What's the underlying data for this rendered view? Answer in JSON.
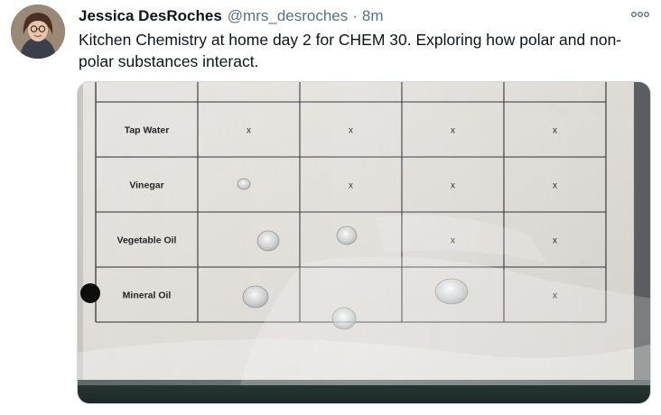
{
  "tweet": {
    "author_name": "Jessica DesRoches",
    "handle": "@mrs_desroches",
    "separator": "·",
    "timestamp": "8m",
    "text": "Kitchen Chemistry at home day 2 for CHEM 30. Exploring how polar and non-polar substances interact."
  },
  "photo": {
    "rows": [
      {
        "label": "Tap Water",
        "cells": [
          "x",
          "x",
          "x",
          "x"
        ]
      },
      {
        "label": "Vinegar",
        "cells": [
          "",
          "x",
          "x",
          "x"
        ]
      },
      {
        "label": "Vegetable Oil",
        "cells": [
          "",
          "",
          "x",
          "x"
        ]
      },
      {
        "label": "Mineral Oil",
        "cells": [
          "",
          "",
          "",
          "x"
        ]
      }
    ]
  },
  "icons": {
    "more": "more-options-icon",
    "avatar": "avatar"
  },
  "colors": {
    "text_primary": "#0f1419",
    "text_secondary": "#5b7083"
  }
}
